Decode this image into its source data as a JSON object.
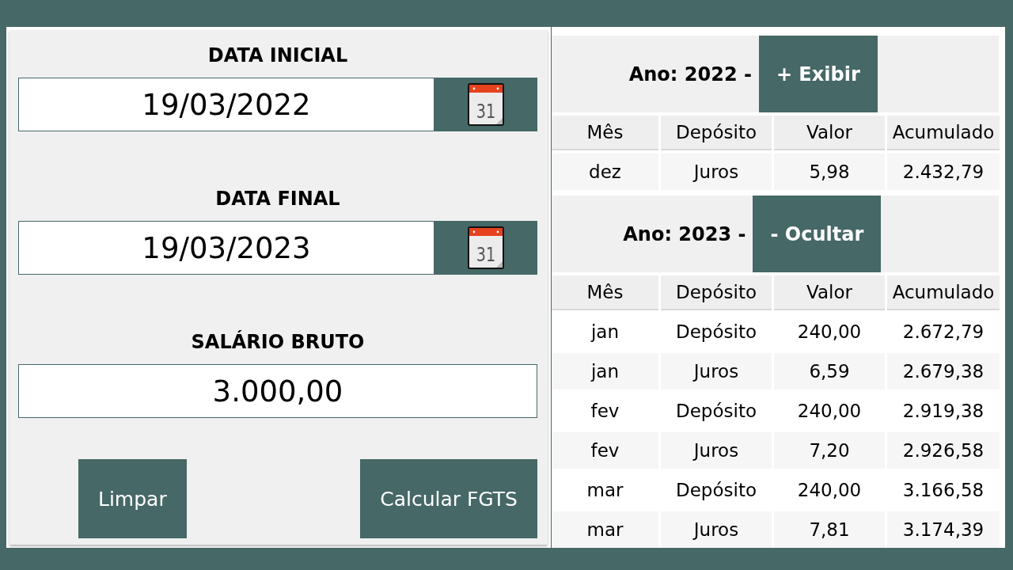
{
  "form": {
    "fields": [
      {
        "kind": "date",
        "label": "DATA INICIAL",
        "value": "19/03/2022",
        "calendar_day": "31"
      },
      {
        "kind": "date",
        "label": "DATA FINAL",
        "value": "19/03/2023",
        "calendar_day": "31"
      },
      {
        "kind": "number",
        "label": "SALÁRIO BRUTO",
        "value": "3.000,00"
      }
    ],
    "buttons": [
      "Limpar",
      "Calcular FGTS"
    ]
  },
  "years": [
    {
      "title": "Ano: 2022 -",
      "toggle": "+ Exibir",
      "columns": [
        "Mês",
        "Depósito",
        "Valor",
        "Acumulado"
      ],
      "rows": [
        {
          "kind": "interest",
          "cells": [
            "dez",
            "Juros",
            "5,98",
            "2.432,79"
          ]
        }
      ]
    },
    {
      "title": "Ano: 2023 -",
      "toggle": "- Ocultar",
      "columns": [
        "Mês",
        "Depósito",
        "Valor",
        "Acumulado"
      ],
      "rows": [
        {
          "kind": "deposit",
          "cells": [
            "jan",
            "Depósito",
            "240,00",
            "2.672,79"
          ]
        },
        {
          "kind": "interest",
          "cells": [
            "jan",
            "Juros",
            "6,59",
            "2.679,38"
          ]
        },
        {
          "kind": "deposit",
          "cells": [
            "fev",
            "Depósito",
            "240,00",
            "2.919,38"
          ]
        },
        {
          "kind": "interest",
          "cells": [
            "fev",
            "Juros",
            "7,20",
            "2.926,58"
          ]
        },
        {
          "kind": "deposit",
          "cells": [
            "mar",
            "Depósito",
            "240,00",
            "3.166,58"
          ]
        },
        {
          "kind": "interest",
          "cells": [
            "mar",
            "Juros",
            "7,81",
            "3.174,39"
          ]
        }
      ]
    }
  ]
}
